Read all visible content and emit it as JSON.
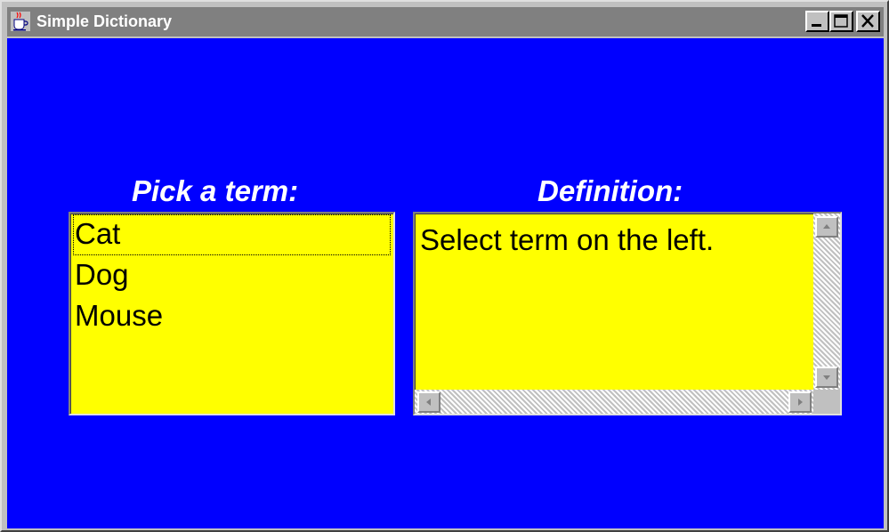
{
  "window": {
    "title": "Simple Dictionary",
    "controls": {
      "minimize": "minimize-icon",
      "maximize": "maximize-icon",
      "close": "close-icon"
    }
  },
  "left_panel": {
    "heading": "Pick a term:",
    "terms": [
      "Cat",
      "Dog",
      "Mouse"
    ],
    "focused_index": 0
  },
  "right_panel": {
    "heading": "Definition:",
    "text": "Select term on the left."
  },
  "colors": {
    "client_background": "#0000ff",
    "field_background": "#ffff00",
    "heading_text": "#ffffff",
    "titlebar_inactive": "#808080"
  }
}
